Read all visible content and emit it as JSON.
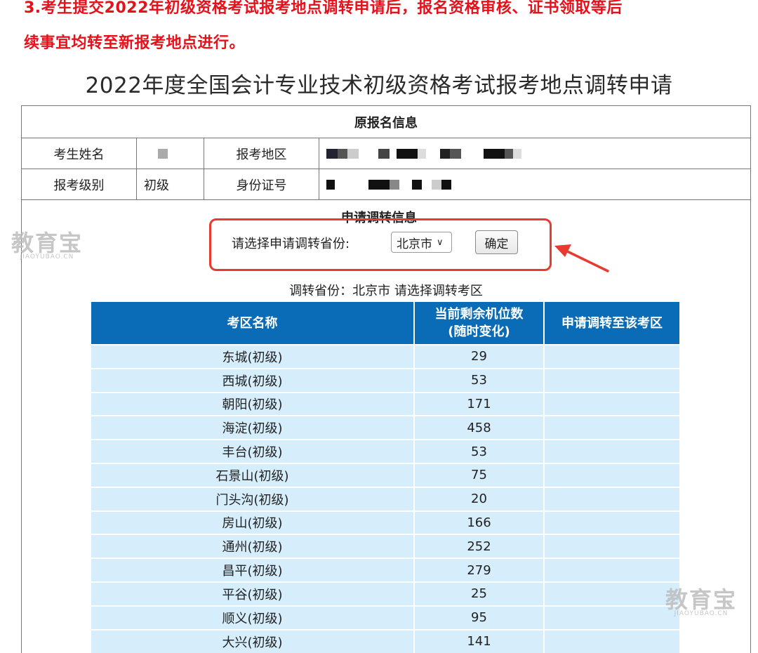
{
  "notice": {
    "line1": "3.考生提交2022年初级资格考试报考地点调转申请后，报名资格审核、证书领取等后",
    "line2": "续事宜均转至新报考地点进行。"
  },
  "page_title": "2022年度全国会计专业技术初级资格考试报考地点调转申请",
  "original_info": {
    "heading": "原报名信息",
    "name_label": "考生姓名",
    "region_label": "报考地区",
    "level_label": "报考级别",
    "level_value": "初级",
    "id_label": "身份证号"
  },
  "transfer": {
    "heading": "申请调转信息",
    "province_prompt": "请选择申请调转省份:",
    "selected_province": "北京市",
    "confirm_label": "确定",
    "status_line": "调转省份：北京市 请选择调转考区"
  },
  "sites_table": {
    "headers": [
      "考区名称",
      "当前剩余机位数\n(随时变化)",
      "申请调转至该考区"
    ],
    "rows": [
      [
        "东城(初级)",
        "29"
      ],
      [
        "西城(初级)",
        "53"
      ],
      [
        "朝阳(初级)",
        "171"
      ],
      [
        "海淀(初级)",
        "458"
      ],
      [
        "丰台(初级)",
        "53"
      ],
      [
        "石景山(初级)",
        "75"
      ],
      [
        "门头沟(初级)",
        "20"
      ],
      [
        "房山(初级)",
        "166"
      ],
      [
        "通州(初级)",
        "252"
      ],
      [
        "昌平(初级)",
        "279"
      ],
      [
        "平谷(初级)",
        "25"
      ],
      [
        "顺义(初级)",
        "95"
      ],
      [
        "大兴(初级)",
        "141"
      ]
    ]
  },
  "watermark": {
    "brand": "教育宝",
    "domain": "JIAOYUBAO.CN"
  },
  "colors": {
    "notice_red": "#e8101a",
    "header_blue": "#0a6cb6",
    "row_blue": "#d6edfb",
    "highlight_red": "#e83a2f"
  }
}
